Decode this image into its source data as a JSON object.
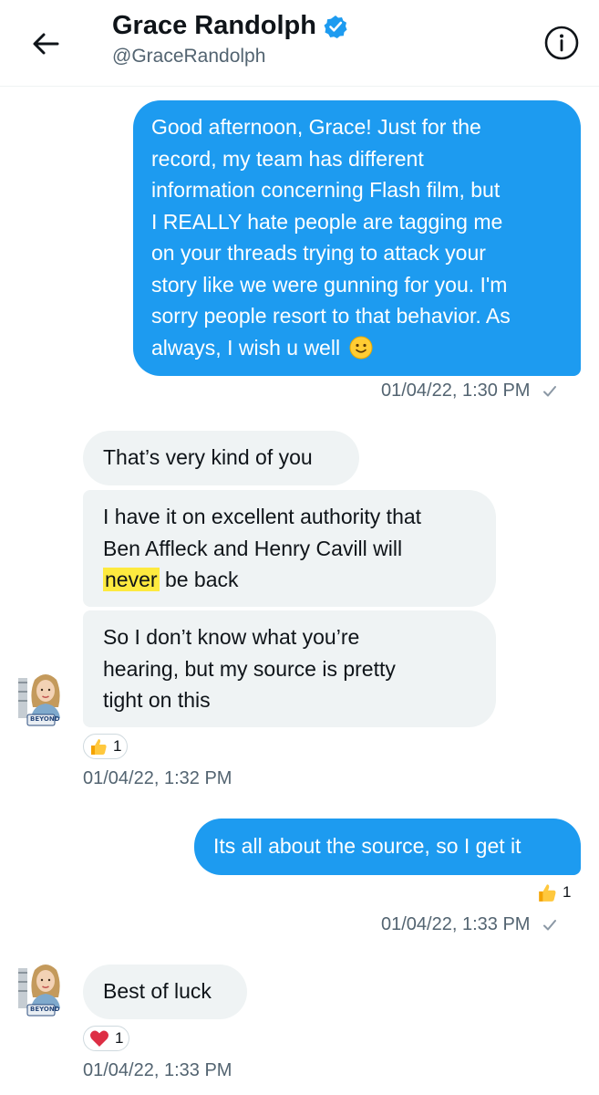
{
  "header": {
    "name": "Grace Randolph",
    "handle": "@GraceRandolph"
  },
  "messages": [
    {
      "direction": "outgoing",
      "lines": [
        "Good afternoon, Grace! Just for the",
        "record, my team has different",
        "information concerning Flash film, but",
        "I REALLY hate people are tagging me",
        "on your threads trying to attack your",
        "story like we were gunning for you. I'm",
        "sorry people resort to that behavior. As",
        "always, I wish u well"
      ],
      "emoji": "slightly-smiling-face",
      "timestamp": "01/04/22, 1:30 PM"
    },
    {
      "direction": "incoming",
      "lines": [
        "That’s very kind of you"
      ]
    },
    {
      "direction": "incoming",
      "lines": [
        "I have it on excellent authority that",
        "Ben Affleck and Henry Cavill will"
      ],
      "highlight_word": "never",
      "line3_rest": "be back"
    },
    {
      "direction": "incoming",
      "lines": [
        "So I don’t know what you’re",
        "hearing, but my source is pretty",
        "tight on this"
      ],
      "reaction": {
        "emoji": "thumbs-up-icon",
        "count": "1"
      },
      "timestamp": "01/04/22, 1:32 PM"
    },
    {
      "direction": "outgoing",
      "lines": [
        "Its all about the source, so I get it"
      ],
      "reaction": {
        "emoji": "thumbs-up-icon",
        "count": "1"
      },
      "timestamp": "01/04/22, 1:33 PM"
    },
    {
      "direction": "incoming",
      "lines": [
        "Best of luck"
      ],
      "reaction": {
        "emoji": "heart-icon",
        "count": "1"
      },
      "timestamp": "01/04/22, 1:33 PM"
    }
  ],
  "avatar": {
    "badge_text": "BEYOND"
  },
  "colors": {
    "outgoing_bubble": "#1d9bf0",
    "incoming_bubble": "#eff3f4",
    "timestamp": "#536471",
    "highlight": "#ffe81e"
  }
}
